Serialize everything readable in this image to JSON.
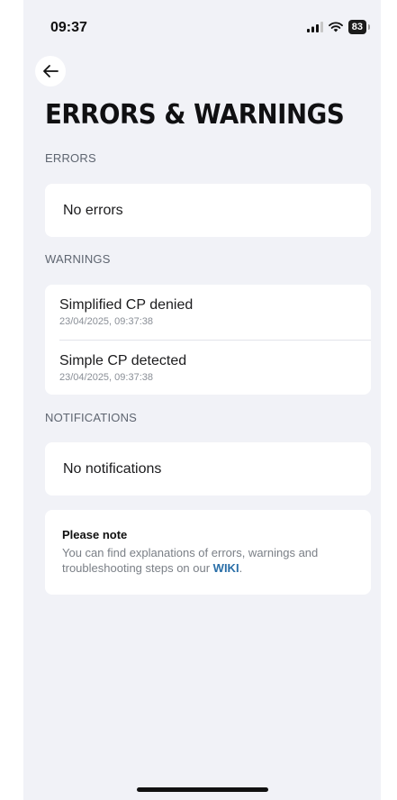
{
  "status_bar": {
    "time": "09:37",
    "battery": "83"
  },
  "page": {
    "title": "ERRORS & WARNINGS"
  },
  "errors": {
    "label": "ERRORS",
    "empty_text": "No errors"
  },
  "warnings": {
    "label": "WARNINGS",
    "items": [
      {
        "title": "Simplified CP denied",
        "timestamp": "23/04/2025, 09:37:38"
      },
      {
        "title": "Simple CP detected",
        "timestamp": "23/04/2025, 09:37:38"
      }
    ]
  },
  "notifications": {
    "label": "NOTIFICATIONS",
    "empty_text": "No notifications"
  },
  "note": {
    "title": "Please note",
    "body": "You can find explanations of errors, warnings and troubleshooting steps on our ",
    "link": "WIKI",
    "suffix": "."
  },
  "colors": {
    "background": "#f1f2f7",
    "card": "#ffffff",
    "link": "#2a6fa8"
  },
  "icons": {
    "back": "arrow-left-icon",
    "signal": "cellular-signal-icon",
    "wifi": "wifi-icon",
    "battery": "battery-icon"
  }
}
